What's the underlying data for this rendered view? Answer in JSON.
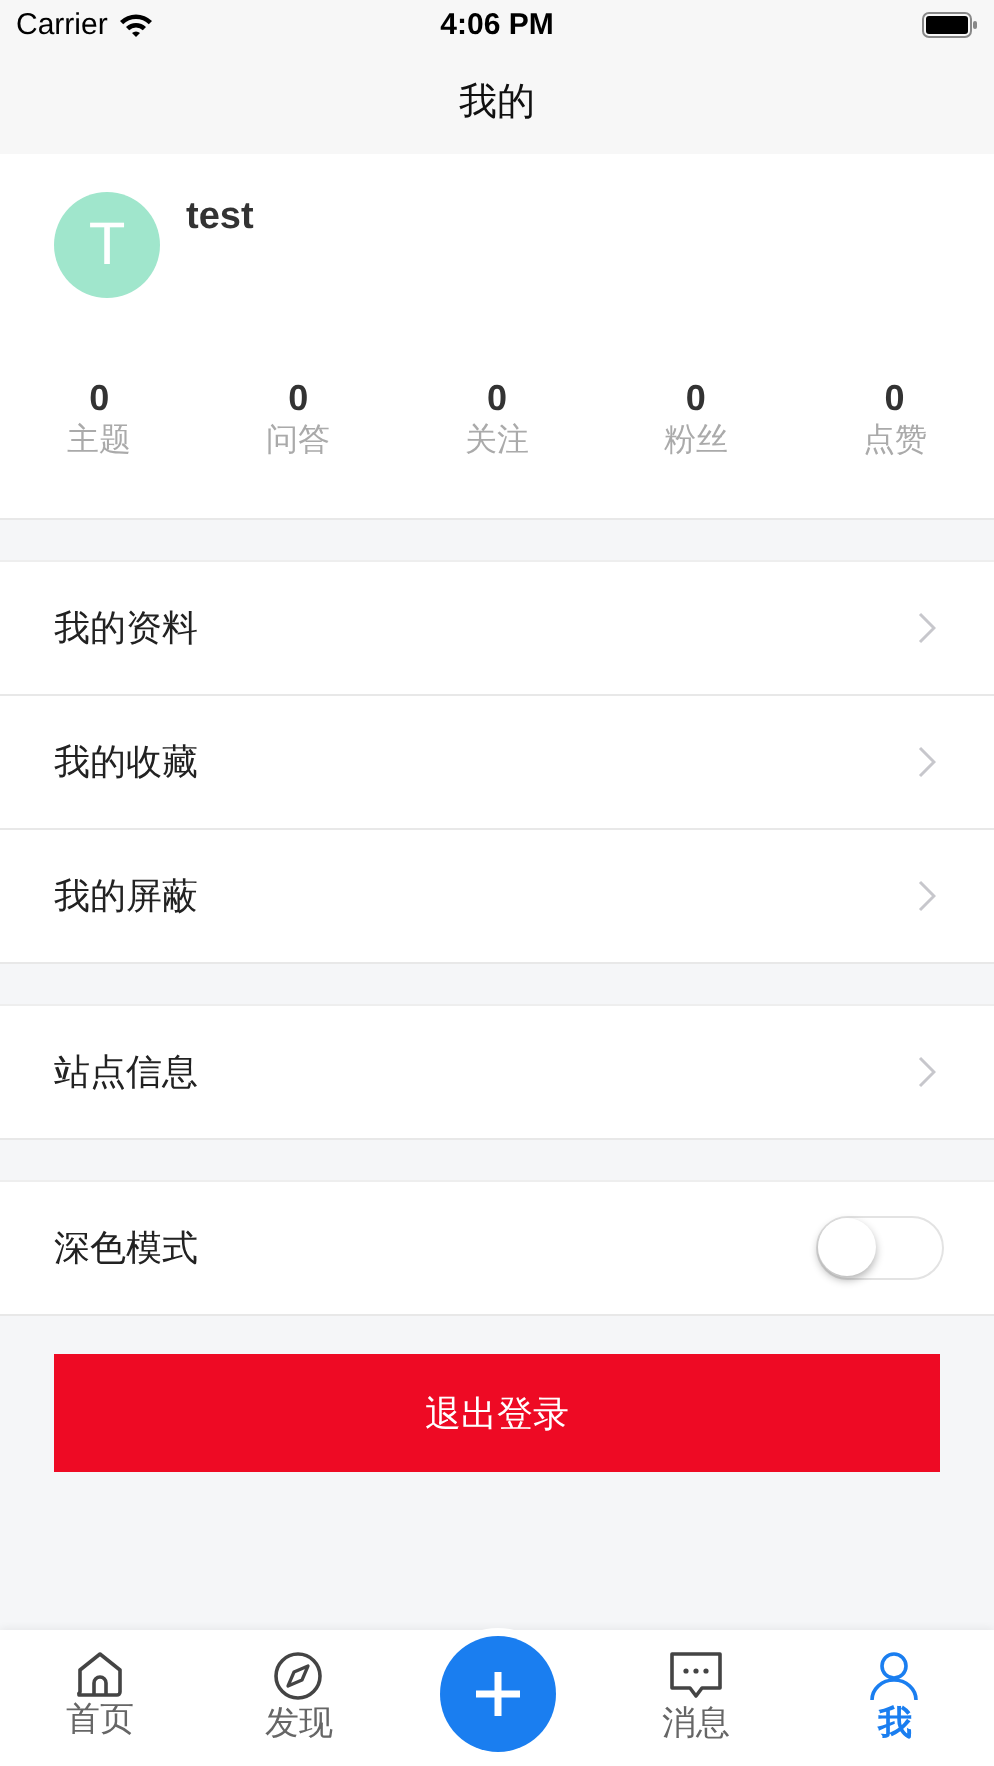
{
  "status_bar": {
    "carrier": "Carrier",
    "time": "4:06 PM"
  },
  "nav_bar": {
    "title": "我的"
  },
  "profile": {
    "avatar_letter": "T",
    "name": "test"
  },
  "stats": [
    {
      "value": "0",
      "label": "主题"
    },
    {
      "value": "0",
      "label": "问答"
    },
    {
      "value": "0",
      "label": "关注"
    },
    {
      "value": "0",
      "label": "粉丝"
    },
    {
      "value": "0",
      "label": "点赞"
    }
  ],
  "menu_groups": [
    [
      {
        "kind": "link",
        "label": "我的资料"
      },
      {
        "kind": "link",
        "label": "我的收藏"
      },
      {
        "kind": "link",
        "label": "我的屏蔽"
      }
    ],
    [
      {
        "kind": "link",
        "label": "站点信息"
      }
    ],
    [
      {
        "kind": "toggle",
        "label": "深色模式",
        "on": false
      }
    ]
  ],
  "logout_button": "退出登录",
  "tabs": [
    {
      "label": "首页",
      "selected": false
    },
    {
      "label": "发现",
      "selected": false
    },
    {
      "label": "消息",
      "selected": false
    },
    {
      "label": "我",
      "selected": true
    }
  ]
}
